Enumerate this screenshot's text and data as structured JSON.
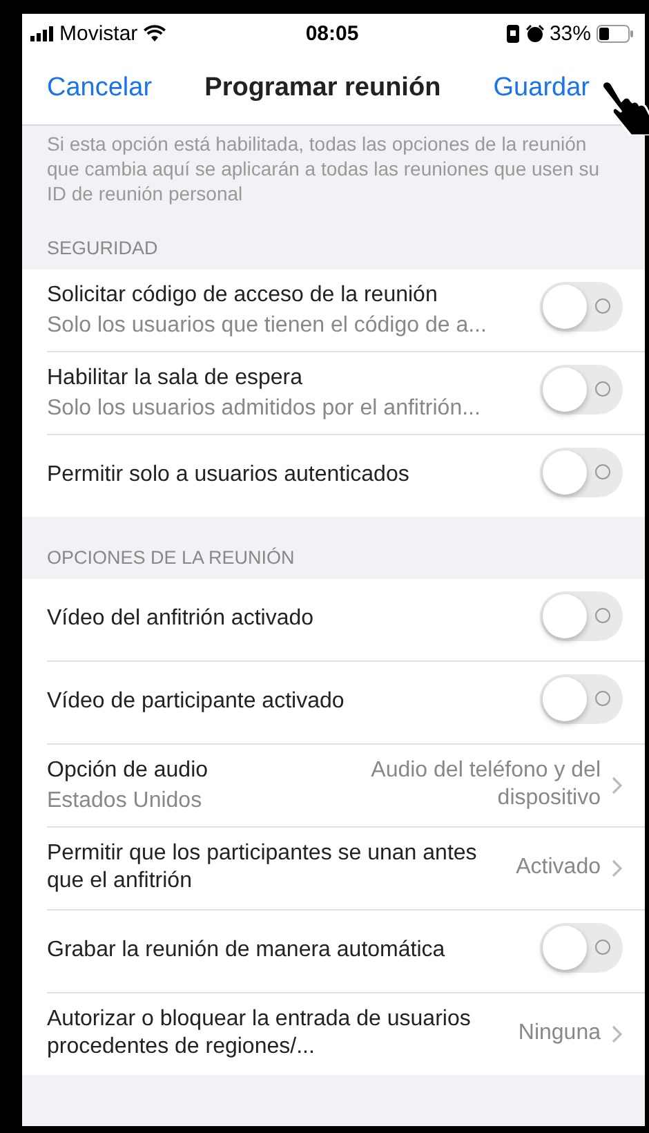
{
  "status_bar": {
    "carrier": "Movistar",
    "time": "08:05",
    "battery": "33%"
  },
  "nav": {
    "cancel": "Cancelar",
    "title": "Programar reunión",
    "save": "Guardar"
  },
  "note": "Si esta opción está habilitada, todas las opciones de la reunión que cambia aquí se aplicarán a todas las reuniones que usen su ID de reunión personal",
  "sections": [
    {
      "header": "SEGURIDAD",
      "rows": [
        {
          "kind": "toggle",
          "label": "Solicitar código de acceso de la reunión",
          "subtitle": "Solo los usuarios que tienen el código de a...",
          "on": false
        },
        {
          "kind": "toggle",
          "label": "Habilitar la sala de espera",
          "subtitle": "Solo los usuarios admitidos por el anfitrión...",
          "on": false
        },
        {
          "kind": "toggle",
          "label": "Permitir solo a usuarios autenticados",
          "on": false
        }
      ]
    },
    {
      "header": "OPCIONES DE LA REUNIÓN",
      "rows": [
        {
          "kind": "toggle",
          "label": "Vídeo del anfitrión activado",
          "on": false
        },
        {
          "kind": "toggle",
          "label": "Vídeo de participante activado",
          "on": false
        },
        {
          "kind": "value",
          "label": "Opción de audio",
          "subtitle": "Estados Unidos",
          "value": "Audio del teléfono y del dispositivo"
        },
        {
          "kind": "value",
          "label": "Permitir que los participantes se unan antes que el anfitrión",
          "value": "Activado"
        },
        {
          "kind": "toggle",
          "label": "Grabar la reunión de manera automática",
          "on": false
        },
        {
          "kind": "value",
          "label": "Autorizar o bloquear la entrada de usuarios procedentes de regiones/...",
          "value": "Ninguna"
        }
      ]
    }
  ]
}
